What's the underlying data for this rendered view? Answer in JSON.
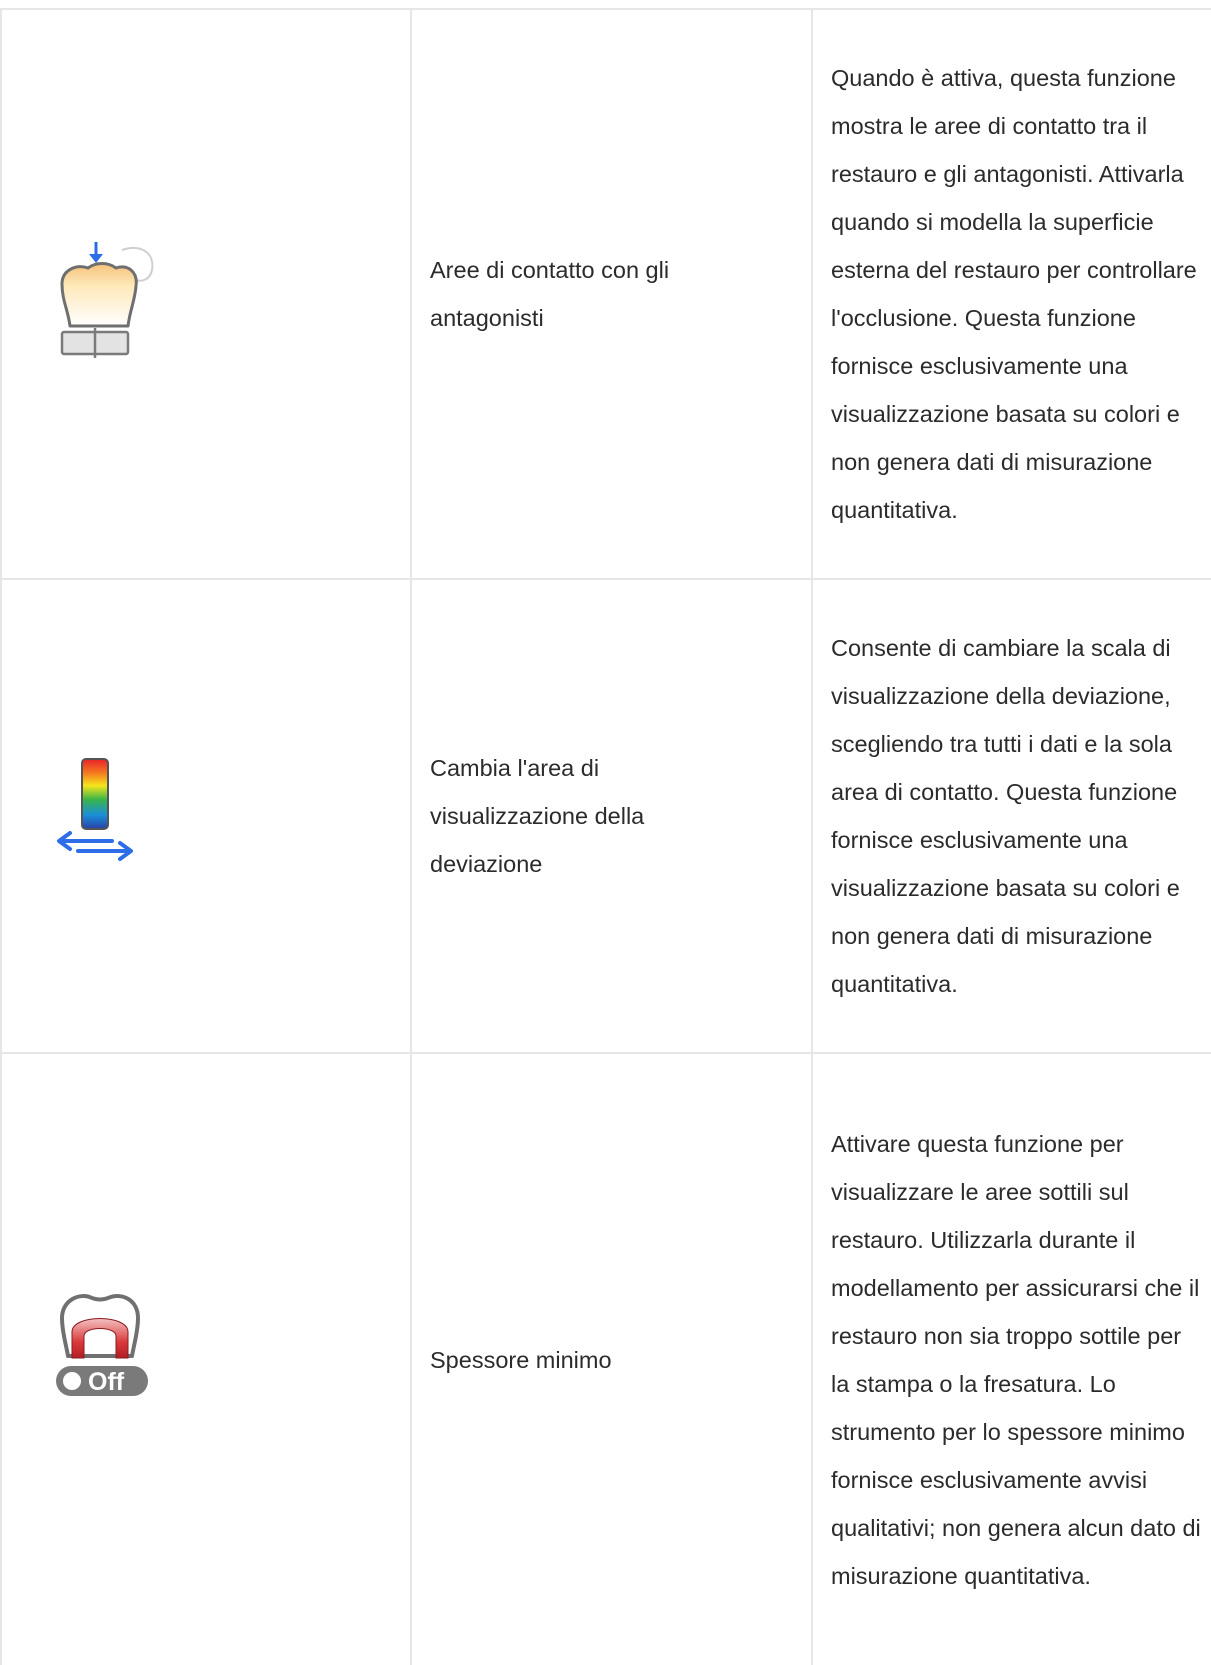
{
  "rows": [
    {
      "icon": "tooth-contact-icon",
      "name": "Aree di contatto con gli antagonisti",
      "description": "Quando è attiva, questa funzione mostra le aree di contatto tra il restauro e gli antagonisti. Attivarla quando si modella la superficie esterna del restauro per controllare l'occlusione. Questa funzione fornisce esclusivamente una visualizzazione basata su colori e non genera dati di misurazione quantitativa."
    },
    {
      "icon": "deviation-scale-icon",
      "name": "Cambia l'area di visualizzazione della deviazione",
      "description": "Consente di cambiare la scala di visualizzazione della deviazione, scegliendo tra tutti i dati e la sola area di contatto. Questa funzione fornisce esclusivamente una visualizzazione basata su colori e non genera dati di misurazione quantitativa."
    },
    {
      "icon": "minimum-thickness-toggle-icon",
      "toggle_label": "Off",
      "name": "Spessore minimo",
      "description": "Attivare questa funzione per visualizzare le aree sottili sul restauro. Utilizzarla durante il modellamento per assicurarsi che il restauro non sia troppo sottile per la stampa o la fresatura. Lo strumento per lo spessore minimo fornisce esclusivamente avvisi qualitativi; non genera alcun dato di misurazione quantitativa."
    }
  ]
}
